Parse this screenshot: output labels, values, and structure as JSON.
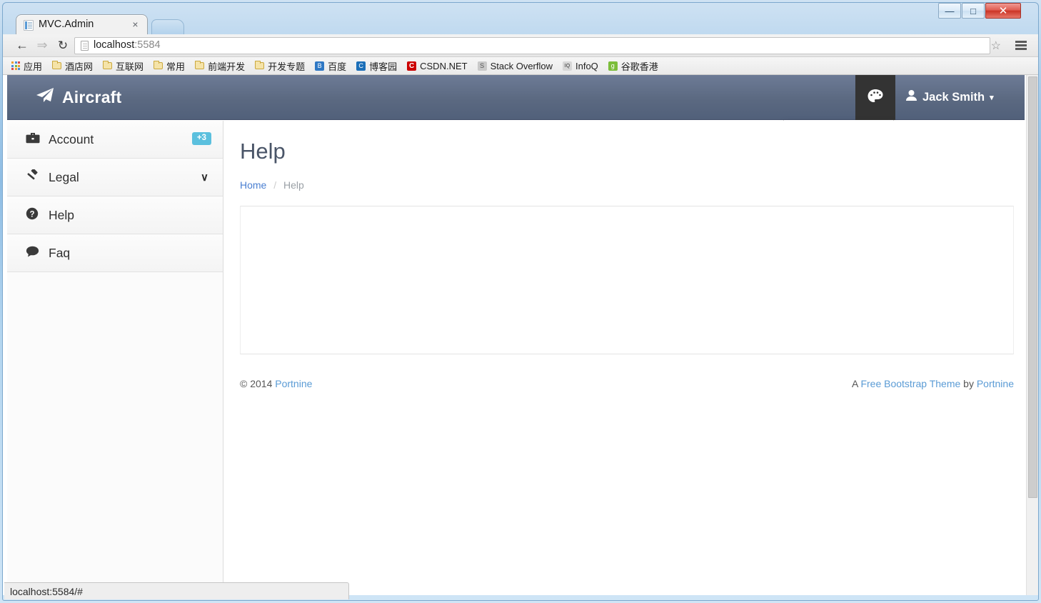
{
  "browser": {
    "tab_title": "MVC.Admin",
    "tab_close": "×",
    "nav": {
      "back": "←",
      "forward": "⇒",
      "reload": "↻"
    },
    "omnibox": {
      "host": "localhost",
      "rest": ":5584",
      "full": "localhost:5584"
    },
    "star": "☆",
    "status_text": "localhost:5584/#",
    "window_controls": {
      "minimize": "—",
      "maximize": "□",
      "close": "✕"
    },
    "bookmarks": [
      {
        "label": "应用",
        "icon": "apps-grid-icon"
      },
      {
        "label": "酒店网",
        "icon": "folder-icon"
      },
      {
        "label": "互联网",
        "icon": "folder-icon"
      },
      {
        "label": "常用",
        "icon": "folder-icon"
      },
      {
        "label": "前端开发",
        "icon": "folder-icon"
      },
      {
        "label": "开发专题",
        "icon": "folder-icon"
      },
      {
        "label": "百度",
        "icon": "baidu-icon"
      },
      {
        "label": "博客园",
        "icon": "bokeyuan-icon"
      },
      {
        "label": "CSDN.NET",
        "icon": "csdn-icon"
      },
      {
        "label": "Stack Overflow",
        "icon": "stackoverflow-icon"
      },
      {
        "label": "InfoQ",
        "icon": "infoq-icon"
      },
      {
        "label": "谷歌香港",
        "icon": "google-icon"
      }
    ]
  },
  "app": {
    "brand": "Aircraft",
    "brand_icon": "paper-plane-icon",
    "theme_toggle_icon": "palette-icon",
    "user": {
      "name": "Jack Smith",
      "icon": "user-icon",
      "caret": "▾"
    },
    "theme_menu": {
      "swatches": [
        "#4a5878",
        "#3b3b3b",
        "#2f4a7d",
        "#4a6b93",
        "#564c2f",
        "#232c3a",
        "#7b7b7b",
        "#5a6050"
      ]
    }
  },
  "sidebar": {
    "items": [
      {
        "label": "Account",
        "icon": "briefcase-icon",
        "glyph": "💼",
        "badge": "+3"
      },
      {
        "label": "Legal",
        "icon": "gavel-icon",
        "glyph": "⚒",
        "chevron": "∨"
      },
      {
        "label": "Help",
        "icon": "question-circle-icon",
        "glyph": "❓"
      },
      {
        "label": "Faq",
        "icon": "comment-icon",
        "glyph": "💬"
      }
    ]
  },
  "main": {
    "title": "Help",
    "breadcrumb": {
      "home": "Home",
      "separator": "/",
      "current": "Help"
    }
  },
  "footer": {
    "copyright_prefix": "© 2014",
    "copyright_link": "Portnine",
    "credit_prefix": "A",
    "credit_link": "Free Bootstrap Theme",
    "credit_mid": "by",
    "credit_link2": "Portnine"
  },
  "colors": {
    "accent_badge": "#5bc0de",
    "header_top": "#6d7b96",
    "header_bottom": "#51607a",
    "link": "#5a9bd5"
  }
}
